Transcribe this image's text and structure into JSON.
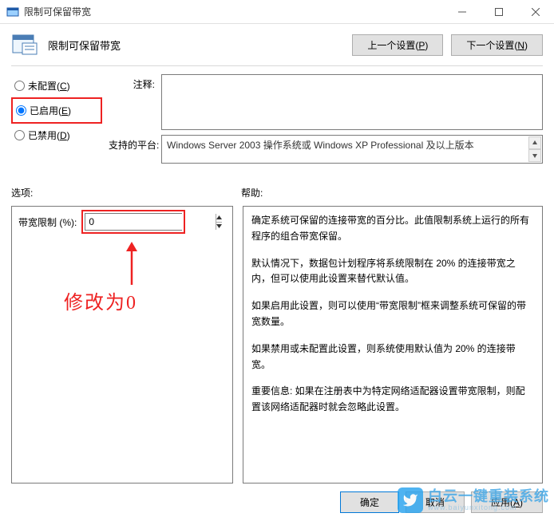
{
  "window": {
    "title": "限制可保留带宽"
  },
  "header": {
    "title": "限制可保留带宽",
    "prev_btn_prefix": "上一个设置(",
    "prev_btn_key": "P",
    "prev_btn_suffix": ")",
    "next_btn_prefix": "下一个设置(",
    "next_btn_key": "N",
    "next_btn_suffix": ")"
  },
  "radios": {
    "not_configured_prefix": "未配置(",
    "not_configured_key": "C",
    "not_configured_suffix": ")",
    "enabled_prefix": "已启用(",
    "enabled_key": "E",
    "enabled_suffix": ")",
    "disabled_prefix": "已禁用(",
    "disabled_key": "D",
    "disabled_suffix": ")",
    "selected": "enabled"
  },
  "labels": {
    "comment": "注释:",
    "platform": "支持的平台:",
    "options": "选项:",
    "help": "帮助:"
  },
  "platform_text": "Windows Server 2003 操作系统或 Windows XP Professional 及以上版本",
  "options": {
    "bandwidth_label": "带宽限制 (%):",
    "bandwidth_value": "0"
  },
  "annotation_text": "修改为0",
  "help": {
    "p1": "确定系统可保留的连接带宽的百分比。此值限制系统上运行的所有程序的组合带宽保留。",
    "p2": "默认情况下，数据包计划程序将系统限制在 20% 的连接带宽之内，但可以使用此设置来替代默认值。",
    "p3": "如果启用此设置，则可以使用“带宽限制”框来调整系统可保留的带宽数量。",
    "p4": "如果禁用或未配置此设置，则系统使用默认值为 20% 的连接带宽。",
    "p5": "重要信息: 如果在注册表中为特定网络适配器设置带宽限制，则配置该网络适配器时就会忽略此设置。"
  },
  "footer": {
    "ok": "确定",
    "cancel": "取消",
    "apply_prefix": "应用(",
    "apply_key": "A",
    "apply_suffix": ")"
  },
  "watermark": {
    "line1": "白云一键重装系统",
    "line2": "www.baiyunxitong.com"
  }
}
